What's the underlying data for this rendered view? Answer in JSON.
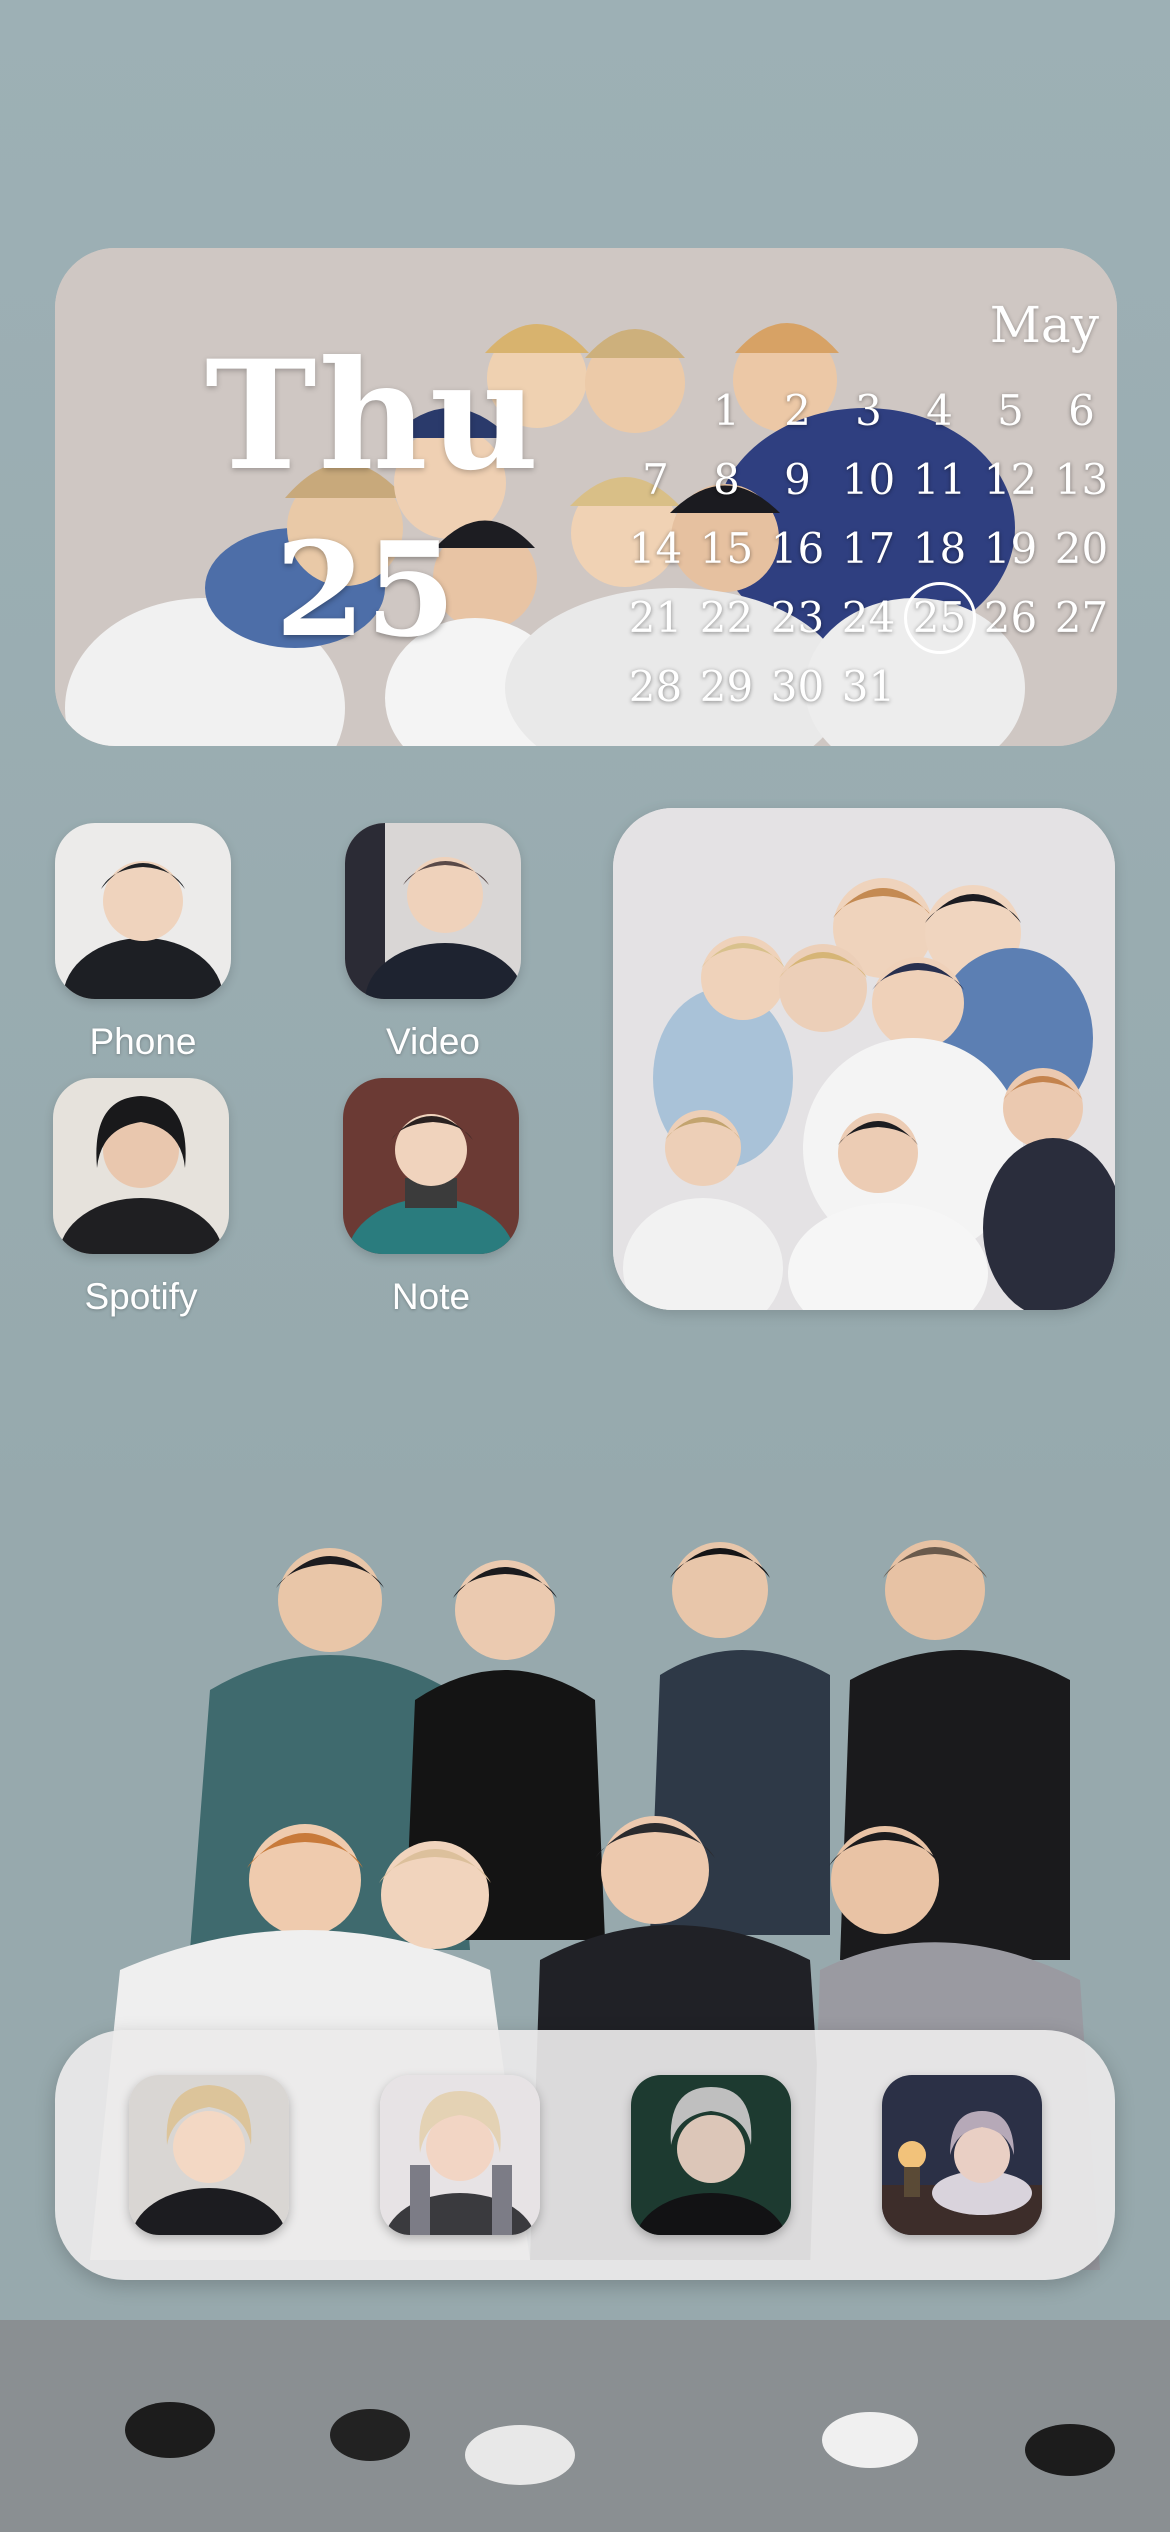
{
  "calendar": {
    "day_name": "Thu",
    "day_number": "25",
    "month": "May",
    "today": "25",
    "weeks": [
      [
        "",
        "1",
        "2",
        "3",
        "4",
        "5",
        "6"
      ],
      [
        "7",
        "8",
        "9",
        "10",
        "11",
        "12",
        "13"
      ],
      [
        "14",
        "15",
        "16",
        "17",
        "18",
        "19",
        "20"
      ],
      [
        "21",
        "22",
        "23",
        "24",
        "25",
        "26",
        "27"
      ],
      [
        "28",
        "29",
        "30",
        "31",
        "",
        "",
        ""
      ]
    ]
  },
  "apps": {
    "phone": "Phone",
    "video": "Video",
    "spotify": "Spotify",
    "note": "Note"
  },
  "dock": {
    "items": [
      {
        "icon": "photo-icon-1"
      },
      {
        "icon": "photo-icon-2"
      },
      {
        "icon": "photo-icon-3"
      },
      {
        "icon": "photo-icon-4"
      }
    ]
  },
  "colors": {
    "background": "#9aabb0",
    "text": "#ffffff",
    "dock": "#eceaea"
  }
}
